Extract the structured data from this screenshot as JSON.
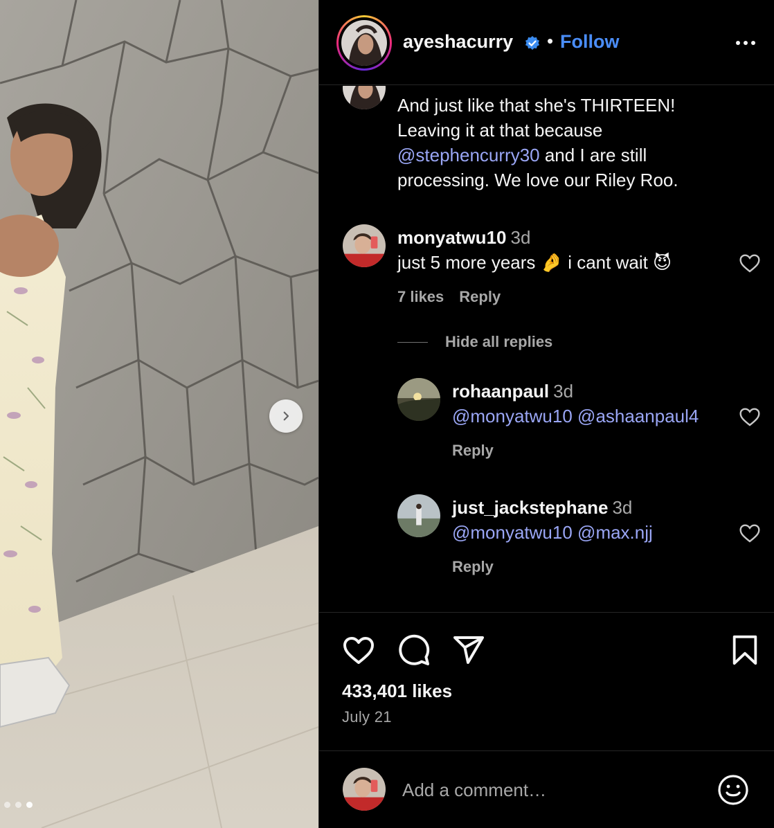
{
  "post": {
    "username": "ayeshacurry",
    "separator": "•",
    "follow_label": "Follow",
    "caption": {
      "line1": "And just like that she's THIRTEEN!",
      "line2": "Leaving it at that because",
      "mention": "@stephencurry30",
      "line3_rest": " and I are still",
      "line4": "processing. We love our Riley Roo."
    }
  },
  "comments": [
    {
      "username": "monyatwu10",
      "time": "3d",
      "text": "just 5 more years 🤌 i cant wait 😈",
      "likes": "7 likes",
      "reply_label": "Reply"
    }
  ],
  "hide_replies_label": "Hide all replies",
  "replies": [
    {
      "username": "rohaanpaul",
      "time": "3d",
      "mention1": "@monyatwu10",
      "mention2": "@ashaanpaul4",
      "reply_label": "Reply"
    },
    {
      "username": "just_jackstephane",
      "time": "3d",
      "mention1": "@monyatwu10",
      "mention2": "@max.njj",
      "reply_label": "Reply"
    }
  ],
  "footer": {
    "likes": "433,401 likes",
    "date": "July 21",
    "add_comment_placeholder": "Add a comment…"
  },
  "icons": {
    "verified": "verified-badge-icon",
    "more": "more-options-icon",
    "like": "heart-icon",
    "comment": "comment-bubble-icon",
    "share": "paper-plane-icon",
    "save": "bookmark-icon",
    "emoji": "emoji-smiley-icon",
    "next": "chevron-right-icon"
  },
  "colors": {
    "background": "#000000",
    "text": "#f5f5f5",
    "secondary_text": "#a8a8a8",
    "link": "#9aa6f5",
    "follow": "#4a8df8",
    "verified": "#3b8cf0"
  },
  "carousel": {
    "slide_count": 3,
    "active_slide": 3
  }
}
